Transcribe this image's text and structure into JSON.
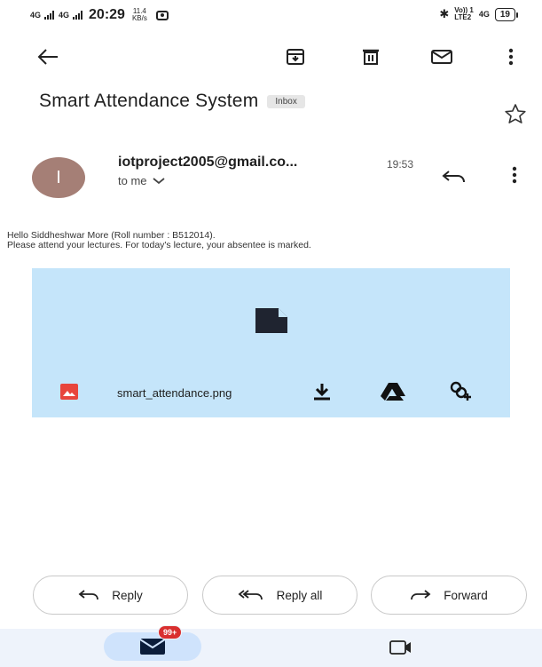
{
  "status_bar": {
    "net1": "4G",
    "net2": "4G",
    "time": "20:29",
    "speed_value": "11.4",
    "speed_unit": "KB/s",
    "volte": "Vo)) 1",
    "lte": "LTE2",
    "net3": "4G",
    "battery": "19"
  },
  "toolbar": {
    "back_icon": "arrow-left-icon",
    "archive_icon": "archive-icon",
    "delete_icon": "trash-icon",
    "mark_unread_icon": "mail-icon",
    "more_icon": "more-vert-icon"
  },
  "message": {
    "subject": "Smart Attendance System",
    "label": "Inbox",
    "avatar_letter": "I",
    "sender": "iotproject2005@gmail.co...",
    "time": "19:53",
    "recipient": "to me",
    "body_line1": "Hello Siddheshwar More (Roll number : B512014).",
    "body_line2": "Please attend your lectures. For today's lecture, your absentee is marked."
  },
  "attachment": {
    "filename": "smart_attendance.png",
    "icons": [
      "file-icon",
      "image-icon",
      "download-icon",
      "drive-icon",
      "photos-add-icon"
    ]
  },
  "actions": {
    "reply": "Reply",
    "reply_all": "Reply all",
    "forward": "Forward"
  },
  "bottom_nav": {
    "mail_badge": "99+"
  },
  "colors": {
    "attachment_bg": "#c5e5fa",
    "avatar_bg": "#a57f76",
    "badge": "#d92f2f",
    "nav_bg": "#eef3fb",
    "nav_active": "#cfe3fc"
  }
}
